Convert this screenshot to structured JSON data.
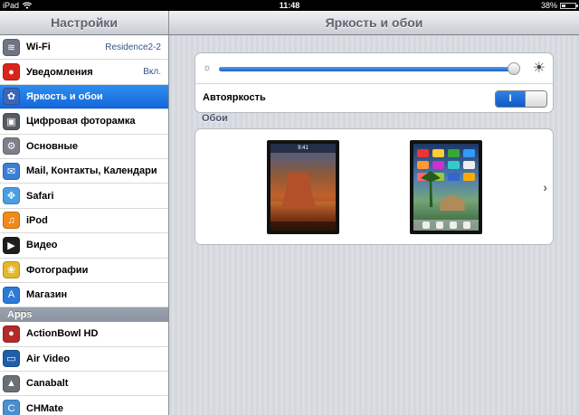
{
  "statusbar": {
    "device": "iPad",
    "time": "11:48",
    "battery": "38%",
    "battery_level": 0.38
  },
  "sidebar": {
    "title": "Настройки",
    "items": [
      {
        "label": "Wi-Fi",
        "value": "Residence2-2",
        "icon": "wifi-icon",
        "color": "#6e7682"
      },
      {
        "label": "Уведомления",
        "value": "Вкл.",
        "icon": "notifications-icon",
        "color": "#d9261c"
      },
      {
        "label": "Яркость и обои",
        "value": "",
        "icon": "brightness-icon",
        "color": "#3b66b8",
        "selected": true
      },
      {
        "label": "Цифровая фоторамка",
        "value": "",
        "icon": "photo-frame-icon",
        "color": "#555b63"
      },
      {
        "label": "Основные",
        "value": "",
        "icon": "gear-icon",
        "color": "#7b8089"
      },
      {
        "label": "Mail, Контакты, Календари",
        "value": "",
        "icon": "mail-icon",
        "color": "#3c7fd6"
      },
      {
        "label": "Safari",
        "value": "",
        "icon": "safari-icon",
        "color": "#4a9fe0"
      },
      {
        "label": "iPod",
        "value": "",
        "icon": "ipod-icon",
        "color": "#f08b1a"
      },
      {
        "label": "Видео",
        "value": "",
        "icon": "video-icon",
        "color": "#1e1e1e"
      },
      {
        "label": "Фотографии",
        "value": "",
        "icon": "photos-icon",
        "color": "#e5b72a"
      },
      {
        "label": "Магазин",
        "value": "",
        "icon": "store-icon",
        "color": "#2d7ad6"
      }
    ],
    "apps_header": "Apps",
    "apps": [
      {
        "label": "ActionBowl HD",
        "icon": "actionbowl-icon",
        "color": "#b32a2a"
      },
      {
        "label": "Air Video",
        "icon": "air-video-icon",
        "color": "#1f5fa8"
      },
      {
        "label": "Canabalt",
        "icon": "canabalt-icon",
        "color": "#6a6f78"
      },
      {
        "label": "CHMate",
        "icon": "chmate-icon",
        "color": "#4a8fd0"
      }
    ]
  },
  "detail": {
    "title": "Яркость и обои",
    "brightness_level": 0.98,
    "auto_brightness_label": "Автояркость",
    "auto_brightness_toggle": "I",
    "wallpaper_label": "Обои",
    "lock_time": "9:41"
  }
}
